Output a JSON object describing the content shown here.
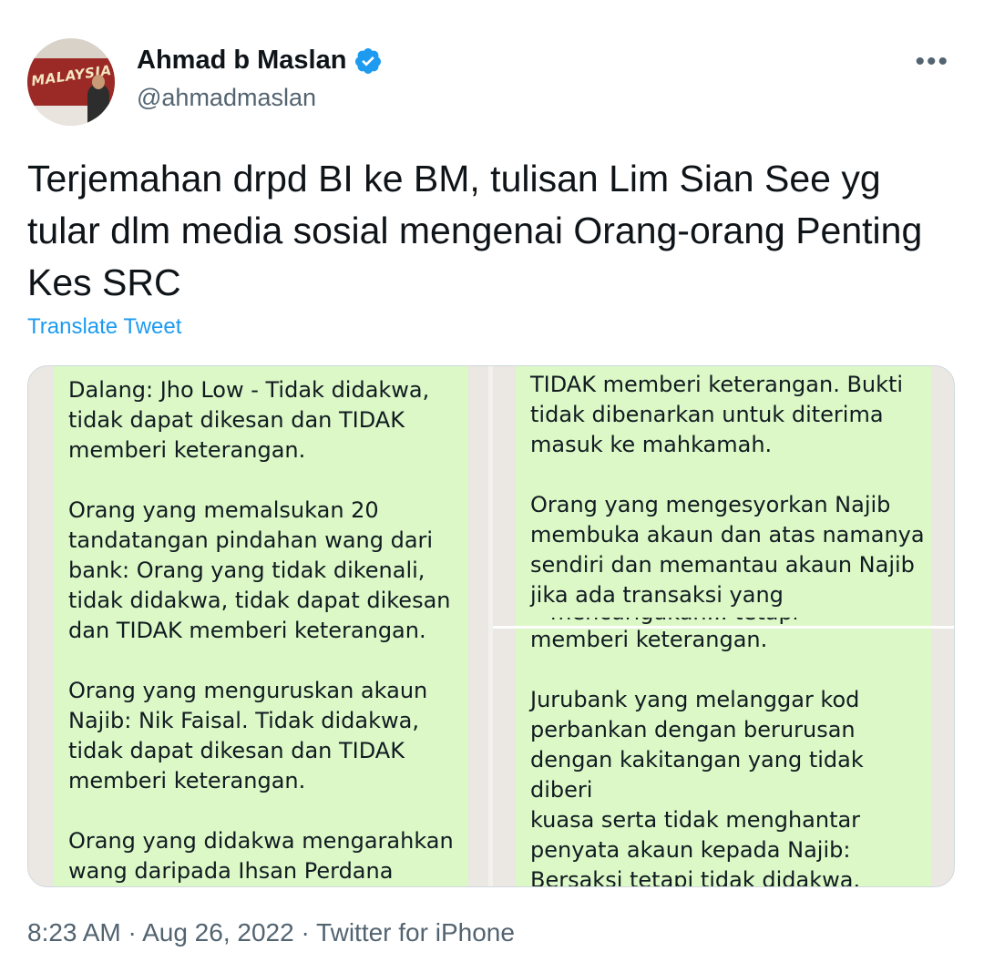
{
  "author": {
    "name": "Ahmad b Maslan",
    "handle": "@ahmadmaslan",
    "avatar_text": "MALAYSIA"
  },
  "tweet": {
    "text": "Terjemahan drpd BI ke BM, tulisan Lim Sian See yg tular dlm media sosial mengenai Orang-orang Penting Kes SRC",
    "translate_label": "Translate Tweet",
    "meta": "8:23 AM · Aug 26, 2022 · Twitter for iPhone"
  },
  "media": {
    "left_message": "Dalang: Jho Low - Tidak didakwa,\ntidak dapat dikesan dan TIDAK\nmemberi keterangan.\n\nOrang yang memalsukan 20\ntandatangan pindahan wang dari\nbank: Orang yang tidak dikenali,\ntidak didakwa, tidak dapat dikesan\ndan TIDAK memberi keterangan.\n\nOrang yang menguruskan akaun\nNajib: Nik Faisal.  Tidak didakwa,\ntidak dapat dikesan dan TIDAK\nmemberi keterangan.\n\nOrang yang didakwa mengarahkan\nwang daripada Ihsan Perdana",
    "right_top_message": "TIDAK memberi keterangan.  Bukti\ntidak dibenarkan untuk diterima\nmasuk ke mahkamah.\n\nOrang yang mengesyorkan Najib\nmembuka akaun dan atas namanya\nsendiri dan memantau akaun Najib\njika ada transaksi yang",
    "right_top_clipped": "mencurigakan... tetapi keluarganya",
    "right_bottom_message": "memberi keterangan.\n\nJurubank yang melanggar kod\nperbankan dengan berurusan\ndengan kakitangan yang tidak diberi\nkuasa serta tidak menghantar\npenyata akaun kepada Najib:\nBersaksi tetapi tidak didakwa."
  },
  "colors": {
    "verified": "#1d9bf0",
    "link": "#1d9bf0",
    "bubble": "#dcf8c6",
    "muted": "#536471"
  },
  "icons": {
    "verified": "verified-badge-icon",
    "more": "more-options-icon"
  }
}
